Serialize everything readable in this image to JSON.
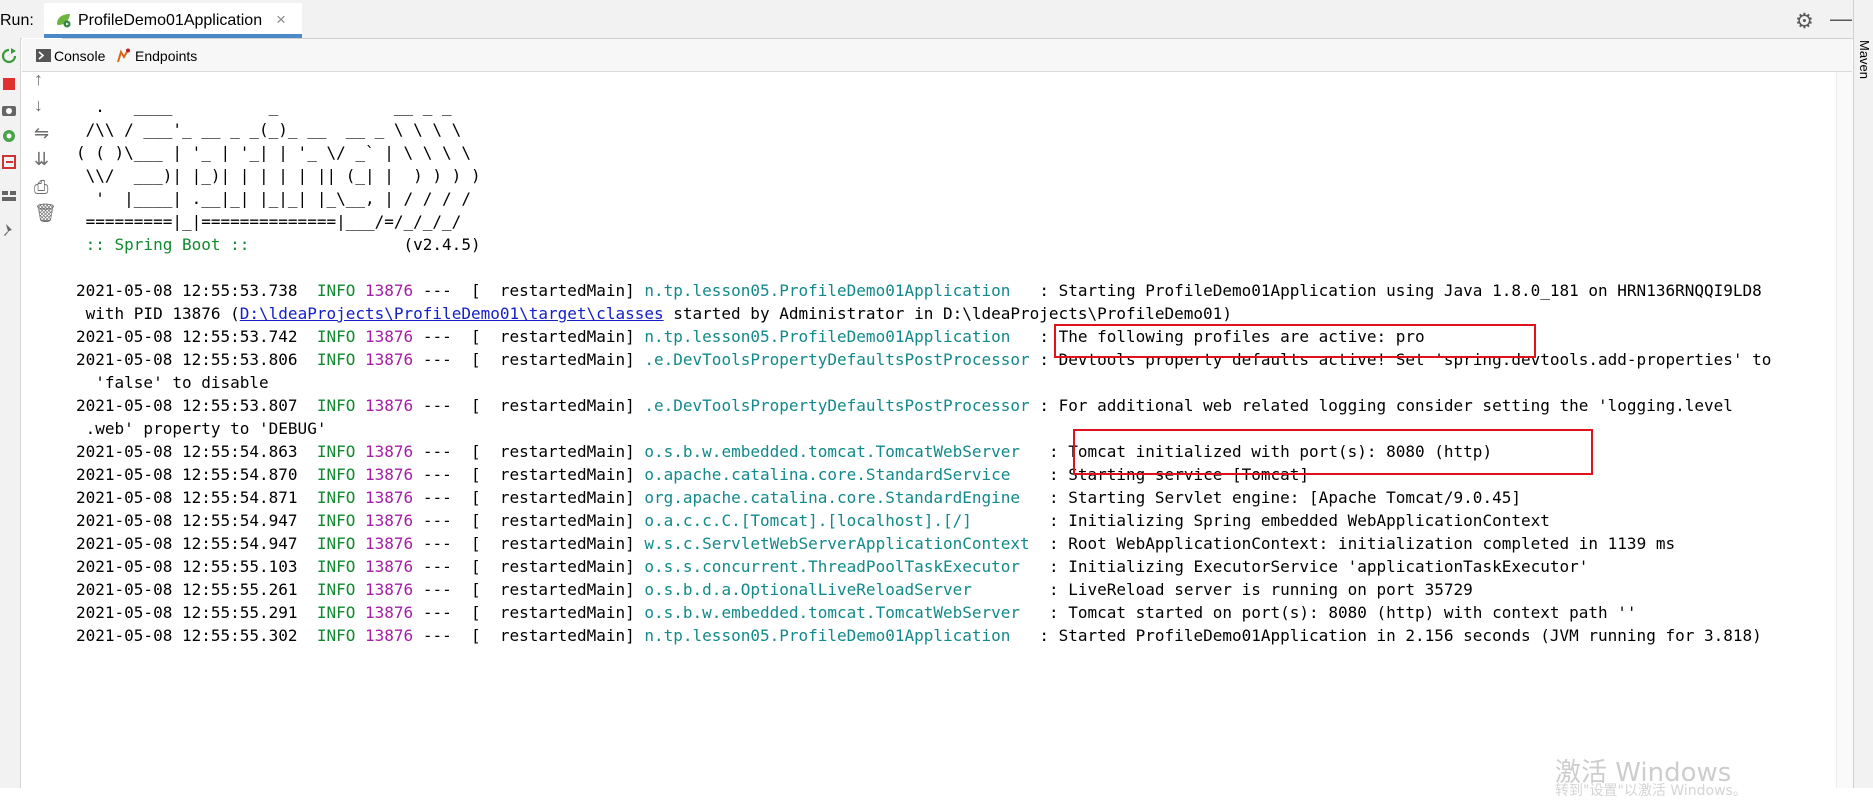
{
  "run_bar": {
    "run_label": "Run:",
    "tab_title": "ProfileDemo01Application",
    "close_glyph": "×",
    "settings_glyph": "⚙",
    "minimize_glyph": "—"
  },
  "subtabs": {
    "console": "Console",
    "endpoints": "Endpoints"
  },
  "right_panel": {
    "maven": "Maven"
  },
  "tool_glyphs": {
    "up": "↑",
    "down": "↓",
    "wrap": "⇋",
    "scroll_end": "⇊",
    "print": "⎙",
    "trash": "🗑"
  },
  "banner": [
    "  .   ____          _            __ _ _",
    " /\\\\ / ___'_ __ _ _(_)_ __  __ _ \\ \\ \\ \\",
    "( ( )\\___ | '_ | '_| | '_ \\/ _` | \\ \\ \\ \\",
    " \\\\/  ___)| |_)| | | | | || (_| |  ) ) ) )",
    "  '  |____| .__|_| |_|_| |_\\__, | / / / /",
    " =========|_|==============|___/=/_/_/_/"
  ],
  "spring_line": " :: Spring Boot ::",
  "spring_version": "                (v2.4.5)",
  "log": [
    {
      "ts": "2021-05-08 12:55:53.738",
      "level": "INFO",
      "pid": "13876",
      "thread": "---  [  restartedMain]",
      "cls": "n.tp.lesson05.ProfileDemo01Application  ",
      "msg": " : Starting ProfileDemo01Application using Java 1.8.0_181 on HRN136RNQQI9LD8"
    },
    {
      "ts": "2021-05-08 12:55:53.742",
      "level": "INFO",
      "pid": "13876",
      "thread": "---  [  restartedMain]",
      "cls": "n.tp.lesson05.ProfileDemo01Application  ",
      "msg": " : The following profiles are active: pro"
    },
    {
      "ts": "2021-05-08 12:55:53.806",
      "level": "INFO",
      "pid": "13876",
      "thread": "---  [  restartedMain]",
      "cls": ".e.DevToolsPropertyDefaultsPostProcessor",
      "msg": " : Devtools property defaults active! Set 'spring.devtools.add-properties' to"
    },
    {
      "ts": "2021-05-08 12:55:53.807",
      "level": "INFO",
      "pid": "13876",
      "thread": "---  [  restartedMain]",
      "cls": ".e.DevToolsPropertyDefaultsPostProcessor",
      "msg": " : For additional web related logging consider setting the 'logging.level"
    },
    {
      "ts": "2021-05-08 12:55:54.863",
      "level": "INFO",
      "pid": "13876",
      "thread": "---  [  restartedMain]",
      "cls": "o.s.b.w.embedded.tomcat.TomcatWebServer  ",
      "msg": " : Tomcat initialized with port(s): 8080 (http)"
    },
    {
      "ts": "2021-05-08 12:55:54.870",
      "level": "INFO",
      "pid": "13876",
      "thread": "---  [  restartedMain]",
      "cls": "o.apache.catalina.core.StandardService   ",
      "msg": " : Starting service [Tomcat]"
    },
    {
      "ts": "2021-05-08 12:55:54.871",
      "level": "INFO",
      "pid": "13876",
      "thread": "---  [  restartedMain]",
      "cls": "org.apache.catalina.core.StandardEngine  ",
      "msg": " : Starting Servlet engine: [Apache Tomcat/9.0.45]"
    },
    {
      "ts": "2021-05-08 12:55:54.947",
      "level": "INFO",
      "pid": "13876",
      "thread": "---  [  restartedMain]",
      "cls": "o.a.c.c.C.[Tomcat].[localhost].[/]       ",
      "msg": " : Initializing Spring embedded WebApplicationContext"
    },
    {
      "ts": "2021-05-08 12:55:54.947",
      "level": "INFO",
      "pid": "13876",
      "thread": "---  [  restartedMain]",
      "cls": "w.s.c.ServletWebServerApplicationContext ",
      "msg": " : Root WebApplicationContext: initialization completed in 1139 ms"
    },
    {
      "ts": "2021-05-08 12:55:55.103",
      "level": "INFO",
      "pid": "13876",
      "thread": "---  [  restartedMain]",
      "cls": "o.s.s.concurrent.ThreadPoolTaskExecutor  ",
      "msg": " : Initializing ExecutorService 'applicationTaskExecutor'"
    },
    {
      "ts": "2021-05-08 12:55:55.261",
      "level": "INFO",
      "pid": "13876",
      "thread": "---  [  restartedMain]",
      "cls": "o.s.b.d.a.OptionalLiveReloadServer       ",
      "msg": " : LiveReload server is running on port 35729"
    },
    {
      "ts": "2021-05-08 12:55:55.291",
      "level": "INFO",
      "pid": "13876",
      "thread": "---  [  restartedMain]",
      "cls": "o.s.b.w.embedded.tomcat.TomcatWebServer  ",
      "msg": " : Tomcat started on port(s): 8080 (http) with context path ''"
    },
    {
      "ts": "2021-05-08 12:55:55.302",
      "level": "INFO",
      "pid": "13876",
      "thread": "---  [  restartedMain]",
      "cls": "n.tp.lesson05.ProfileDemo01Application  ",
      "msg": " : Started ProfileDemo01Application in 2.156 seconds (JVM running for 3.818)"
    }
  ],
  "continuation": {
    "pid_prefix": " with PID 13876 (",
    "link": "D:\\ldeaProjects\\ProfileDemo01\\target\\classes",
    "pid_suffix": " started by Administrator in D:\\ldeaProjects\\ProfileDemo01)",
    "devtools": "  'false' to disable",
    "logging": " .web' property to 'DEBUG'"
  },
  "watermark": {
    "line1": "激活 Windows",
    "line2": "转到\"设置\"以激活 Windows。"
  },
  "colors": {
    "info": "#11892e",
    "pid": "#a51ea5",
    "class": "#12898a",
    "link": "#1320c7",
    "highlight": "#e0121b",
    "tab_accent": "#4a88c7"
  }
}
